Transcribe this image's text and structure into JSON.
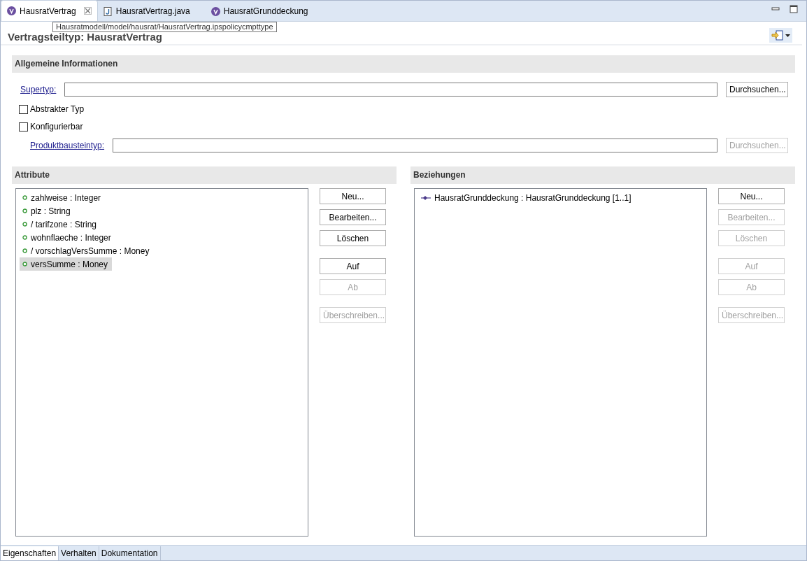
{
  "editor_tabs": [
    {
      "label": "HausratVertrag",
      "kind": "ips",
      "selected": true
    },
    {
      "label": "HausratVertrag.java",
      "kind": "java",
      "selected": false
    },
    {
      "label": "HausratGrunddeckung",
      "kind": "ips",
      "selected": false
    }
  ],
  "tooltip": "Hausratmodell/model/hausrat/HausratVertrag.ipspolicycmpttype",
  "title": "Vertragsteiltyp: HausratVertrag",
  "general": {
    "heading": "Allgemeine Informationen",
    "supertype": {
      "label": "Supertyp:",
      "button": {
        "label": "Durchsuchen...",
        "disabled": false
      }
    },
    "checkboxes": [
      {
        "label": "Abstrakter Typ",
        "checked": false
      },
      {
        "label": "Konfigurierbar",
        "checked": false
      }
    ],
    "product_type": {
      "label": "Produktbausteintyp:",
      "button": {
        "label": "Durchsuchen...",
        "disabled": true
      }
    }
  },
  "panels": [
    {
      "heading": "Attribute",
      "kind": "attribute",
      "items": [
        {
          "label": "zahlweise : Integer",
          "selected": false
        },
        {
          "label": "plz : String",
          "selected": false
        },
        {
          "label": "/ tarifzone : String",
          "selected": false
        },
        {
          "label": "wohnflaeche : Integer",
          "selected": false
        },
        {
          "label": "/ vorschlagVersSumme : Money",
          "selected": false
        },
        {
          "label": "versSumme : Money",
          "selected": true
        }
      ],
      "buttons": [
        {
          "label": "Neu...",
          "disabled": false
        },
        {
          "label": "Bearbeiten...",
          "disabled": false
        },
        {
          "label": "Löschen",
          "disabled": false
        },
        {
          "label": "Auf",
          "disabled": false
        },
        {
          "label": "Ab",
          "disabled": true
        },
        {
          "label": "Überschreiben...",
          "disabled": true
        }
      ]
    },
    {
      "heading": "Beziehungen",
      "kind": "association",
      "items": [
        {
          "label": "HausratGrunddeckung : HausratGrunddeckung [1..1]",
          "selected": false
        }
      ],
      "buttons": [
        {
          "label": "Neu...",
          "disabled": false
        },
        {
          "label": "Bearbeiten...",
          "disabled": true
        },
        {
          "label": "Löschen",
          "disabled": true
        },
        {
          "label": "Auf",
          "disabled": true
        },
        {
          "label": "Ab",
          "disabled": true
        },
        {
          "label": "Überschreiben...",
          "disabled": true
        }
      ]
    }
  ],
  "page_tabs": [
    {
      "label": "Eigenschaften",
      "selected": true
    },
    {
      "label": "Verhalten",
      "selected": false
    },
    {
      "label": "Dokumentation",
      "selected": false
    }
  ]
}
